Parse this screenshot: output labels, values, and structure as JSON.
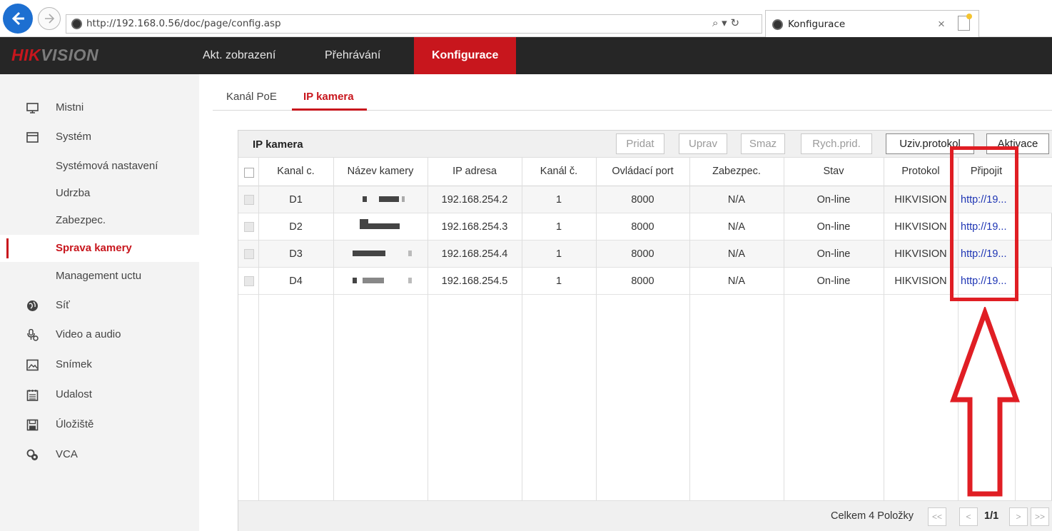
{
  "browser": {
    "url": "http://192.168.0.56/doc/page/config.asp",
    "url_tools": "⌕ ▾ ↻",
    "tab_title": "Konfigurace",
    "tab_close": "×"
  },
  "header": {
    "logo_red": "HIK",
    "logo_gray": "VISION",
    "nav": [
      {
        "label": "Akt. zobrazení"
      },
      {
        "label": "Přehrávání"
      },
      {
        "label": "Konfigurace",
        "active": true
      }
    ]
  },
  "sidebar": {
    "items": [
      {
        "label": "Mistni",
        "icon": "monitor-icon"
      },
      {
        "label": "Systém",
        "icon": "window-icon"
      },
      {
        "label": "Systémová nastavení"
      },
      {
        "label": "Udrzba"
      },
      {
        "label": "Zabezpec."
      },
      {
        "label": "Sprava kamery",
        "active": true
      },
      {
        "label": "Management uctu"
      },
      {
        "label": "Síť",
        "icon": "globe-icon"
      },
      {
        "label": "Video a audio",
        "icon": "microphone-icon"
      },
      {
        "label": "Snímek",
        "icon": "image-icon"
      },
      {
        "label": "Udalost",
        "icon": "calendar-icon"
      },
      {
        "label": "Úložiště",
        "icon": "save-icon"
      },
      {
        "label": "VCA",
        "icon": "vca-icon"
      }
    ]
  },
  "content_tabs": [
    {
      "label": "Kanál PoE"
    },
    {
      "label": "IP kamera",
      "active": true
    }
  ],
  "panel": {
    "title": "IP kamera",
    "buttons": {
      "add": "Pridat",
      "edit": "Uprav",
      "delete": "Smaz",
      "quick_add": "Rych.prid.",
      "user_protocol": "Uziv.protokol",
      "activate": "Aktivace"
    },
    "columns": [
      "Kanal c.",
      "Název kamery",
      "IP adresa",
      "Kanál č.",
      "Ovládací port",
      "Zabezpec.",
      "Stav",
      "Protokol",
      "Připojit"
    ],
    "rows": [
      {
        "channel": "D1",
        "ip": "192.168.254.2",
        "ch_no": "1",
        "port": "8000",
        "security": "N/A",
        "status": "On-line",
        "protocol": "HIKVISION",
        "connect": "http://19..."
      },
      {
        "channel": "D2",
        "ip": "192.168.254.3",
        "ch_no": "1",
        "port": "8000",
        "security": "N/A",
        "status": "On-line",
        "protocol": "HIKVISION",
        "connect": "http://19..."
      },
      {
        "channel": "D3",
        "ip": "192.168.254.4",
        "ch_no": "1",
        "port": "8000",
        "security": "N/A",
        "status": "On-line",
        "protocol": "HIKVISION",
        "connect": "http://19..."
      },
      {
        "channel": "D4",
        "ip": "192.168.254.5",
        "ch_no": "1",
        "port": "8000",
        "security": "N/A",
        "status": "On-line",
        "protocol": "HIKVISION",
        "connect": "http://19..."
      }
    ],
    "footer": {
      "total": "Celkem 4 Položky",
      "first": "<<",
      "prev": "<",
      "page": "1/1",
      "next": ">",
      "last": ">>"
    }
  },
  "colors": {
    "brand_red": "#c8161d",
    "header_bg": "#262626",
    "annotation_red": "#e01e24",
    "link_blue": "#1e35b4"
  }
}
